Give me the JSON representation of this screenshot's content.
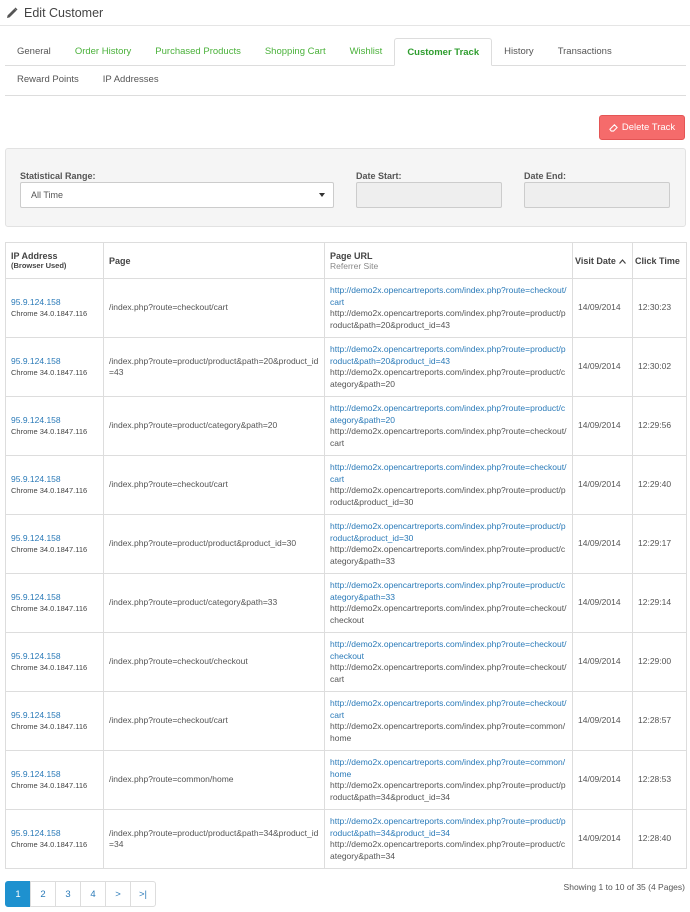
{
  "header": {
    "title": "Edit Customer",
    "icon": "pencil-icon"
  },
  "tabs": {
    "row1": [
      {
        "label": "General",
        "style": "plain"
      },
      {
        "label": "Order History",
        "style": "green"
      },
      {
        "label": "Purchased Products",
        "style": "green"
      },
      {
        "label": "Shopping Cart",
        "style": "green"
      },
      {
        "label": "Wishlist",
        "style": "green"
      },
      {
        "label": "Customer Track",
        "style": "active"
      },
      {
        "label": "History",
        "style": "plain"
      },
      {
        "label": "Transactions",
        "style": "plain"
      }
    ],
    "row2": [
      {
        "label": "Reward Points",
        "style": "plain"
      },
      {
        "label": "IP Addresses",
        "style": "plain"
      }
    ]
  },
  "actions": {
    "delete_label": "Delete Track",
    "delete_color": "#f56b6b"
  },
  "filter": {
    "range_label": "Statistical Range:",
    "range_value": "All Time",
    "date_start_label": "Date Start:",
    "date_start_value": "",
    "date_end_label": "Date End:",
    "date_end_value": ""
  },
  "table": {
    "headers": {
      "ip": "IP Address",
      "ip_sub": "(Browser Used)",
      "page": "Page",
      "url": "Page URL",
      "url_sub": "Referrer Site",
      "visit": "Visit Date",
      "click": "Click Time"
    },
    "rows": [
      {
        "ip": "95.9.124.158",
        "browser": "Chrome 34.0.1847.116",
        "page": "/index.php?route=checkout/cart",
        "url": "http://demo2x.opencartreports.com/index.php?route=checkout/cart",
        "ref": "http://demo2x.opencartreports.com/index.php?route=product/product&path=20&product_id=43",
        "date": "14/09/2014",
        "time": "12:30:23"
      },
      {
        "ip": "95.9.124.158",
        "browser": "Chrome 34.0.1847.116",
        "page": "/index.php?route=product/product&path=20&product_id=43",
        "url": "http://demo2x.opencartreports.com/index.php?route=product/product&path=20&product_id=43",
        "ref": "http://demo2x.opencartreports.com/index.php?route=product/category&path=20",
        "date": "14/09/2014",
        "time": "12:30:02"
      },
      {
        "ip": "95.9.124.158",
        "browser": "Chrome 34.0.1847.116",
        "page": "/index.php?route=product/category&path=20",
        "url": "http://demo2x.opencartreports.com/index.php?route=product/category&path=20",
        "ref": "http://demo2x.opencartreports.com/index.php?route=checkout/cart",
        "date": "14/09/2014",
        "time": "12:29:56"
      },
      {
        "ip": "95.9.124.158",
        "browser": "Chrome 34.0.1847.116",
        "page": "/index.php?route=checkout/cart",
        "url": "http://demo2x.opencartreports.com/index.php?route=checkout/cart",
        "ref": "http://demo2x.opencartreports.com/index.php?route=product/product&product_id=30",
        "date": "14/09/2014",
        "time": "12:29:40"
      },
      {
        "ip": "95.9.124.158",
        "browser": "Chrome 34.0.1847.116",
        "page": "/index.php?route=product/product&product_id=30",
        "url": "http://demo2x.opencartreports.com/index.php?route=product/product&product_id=30",
        "ref": "http://demo2x.opencartreports.com/index.php?route=product/category&path=33",
        "date": "14/09/2014",
        "time": "12:29:17"
      },
      {
        "ip": "95.9.124.158",
        "browser": "Chrome 34.0.1847.116",
        "page": "/index.php?route=product/category&path=33",
        "url": "http://demo2x.opencartreports.com/index.php?route=product/category&path=33",
        "ref": "http://demo2x.opencartreports.com/index.php?route=checkout/checkout",
        "date": "14/09/2014",
        "time": "12:29:14"
      },
      {
        "ip": "95.9.124.158",
        "browser": "Chrome 34.0.1847.116",
        "page": "/index.php?route=checkout/checkout",
        "url": "http://demo2x.opencartreports.com/index.php?route=checkout/checkout",
        "ref": "http://demo2x.opencartreports.com/index.php?route=checkout/cart",
        "date": "14/09/2014",
        "time": "12:29:00"
      },
      {
        "ip": "95.9.124.158",
        "browser": "Chrome 34.0.1847.116",
        "page": "/index.php?route=checkout/cart",
        "url": "http://demo2x.opencartreports.com/index.php?route=checkout/cart",
        "ref": "http://demo2x.opencartreports.com/index.php?route=common/home",
        "date": "14/09/2014",
        "time": "12:28:57"
      },
      {
        "ip": "95.9.124.158",
        "browser": "Chrome 34.0.1847.116",
        "page": "/index.php?route=common/home",
        "url": "http://demo2x.opencartreports.com/index.php?route=common/home",
        "ref": "http://demo2x.opencartreports.com/index.php?route=product/product&path=34&product_id=34",
        "date": "14/09/2014",
        "time": "12:28:53"
      },
      {
        "ip": "95.9.124.158",
        "browser": "Chrome 34.0.1847.116",
        "page": "/index.php?route=product/product&path=34&product_id=34",
        "url": "http://demo2x.opencartreports.com/index.php?route=product/product&path=34&product_id=34",
        "ref": "http://demo2x.opencartreports.com/index.php?route=product/category&path=34",
        "date": "14/09/2014",
        "time": "12:28:40"
      }
    ]
  },
  "pagination": {
    "pages": [
      "1",
      "2",
      "3",
      "4",
      ">",
      ">|"
    ],
    "active": "1",
    "summary": "Showing 1 to 10 of 35 (4 Pages)"
  },
  "colors": {
    "accent": "#1e91cf",
    "link": "#2a7ab8",
    "green_tab": "#4ab13a"
  }
}
